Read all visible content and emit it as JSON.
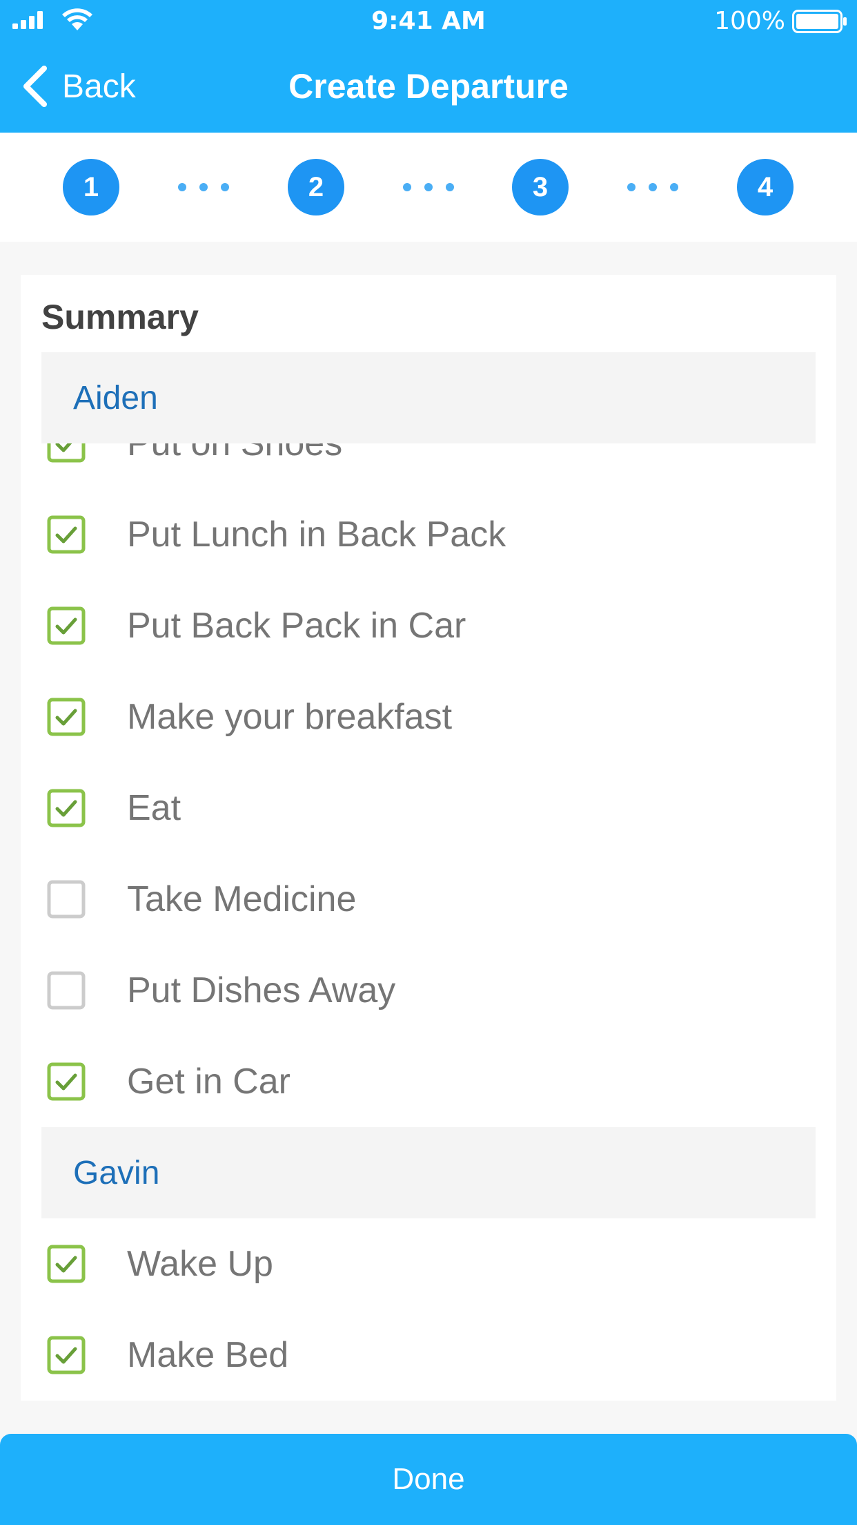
{
  "status_bar": {
    "time": "9:41 AM",
    "battery": "100%",
    "icons": [
      "signal-icon",
      "wifi-icon",
      "battery-icon"
    ]
  },
  "nav": {
    "back_label": "Back",
    "title": "Create Departure",
    "back_icon": "chevron-left-icon"
  },
  "stepper": {
    "steps": [
      "1",
      "2",
      "3",
      "4"
    ]
  },
  "summary": {
    "title": "Summary",
    "sections": [
      {
        "name": "Aiden",
        "tasks": [
          {
            "label": "Put on Shoes",
            "checked": true
          },
          {
            "label": "Put Lunch in Back Pack",
            "checked": true
          },
          {
            "label": "Put Back Pack in Car",
            "checked": true
          },
          {
            "label": "Make your breakfast",
            "checked": true
          },
          {
            "label": "Eat",
            "checked": true
          },
          {
            "label": "Take Medicine",
            "checked": false
          },
          {
            "label": "Put Dishes Away",
            "checked": false
          },
          {
            "label": "Get in Car",
            "checked": true
          }
        ]
      },
      {
        "name": "Gavin",
        "tasks": [
          {
            "label": "Wake Up",
            "checked": true
          },
          {
            "label": "Make Bed",
            "checked": true
          }
        ]
      }
    ]
  },
  "footer": {
    "done_label": "Done"
  },
  "colors": {
    "header": "#1eb0fb",
    "step": "#1e95f3",
    "section_text": "#1d6fb8",
    "checked": "#8bc34a",
    "unchecked": "#cccccc"
  }
}
